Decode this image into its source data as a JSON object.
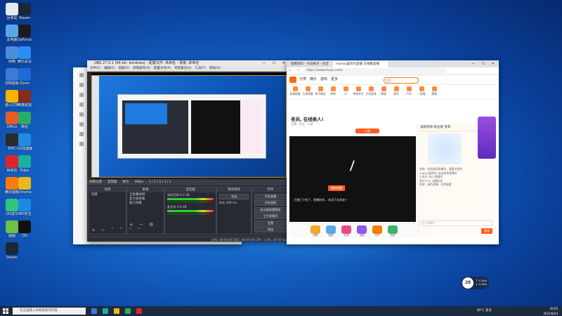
{
  "desktop": {
    "icons": [
      {
        "label": "回收站",
        "color": "#e6e9ee"
      },
      {
        "label": "Steam",
        "color": "#1b2838"
      },
      {
        "label": "此电脑",
        "color": "#5aa7e8"
      },
      {
        "label": "GeForce",
        "color": "#1c1c1c"
      },
      {
        "label": "网络",
        "color": "#4a8fd8"
      },
      {
        "label": "腾讯会议",
        "color": "#2d8cf0"
      },
      {
        "label": "控制面板",
        "color": "#3a7bd5"
      },
      {
        "label": "Zoom",
        "color": "#1e6ad6"
      },
      {
        "label": "金山文档",
        "color": "#f5b400"
      },
      {
        "label": "英雄联盟",
        "color": "#8a2a1a"
      },
      {
        "label": "Office",
        "color": "#e65b2a"
      },
      {
        "label": "微信",
        "color": "#2aae67"
      },
      {
        "label": "EPIC",
        "color": "#2a2a2a"
      },
      {
        "label": "UU加速器",
        "color": "#1f8ce3"
      },
      {
        "label": "网易云",
        "color": "#e0242a"
      },
      {
        "label": "Edge",
        "color": "#1bb0a1"
      },
      {
        "label": "腾讯视频",
        "color": "#ff7a00"
      },
      {
        "label": "Chrome",
        "color": "#e8b91f"
      },
      {
        "label": "QQ音乐",
        "color": "#31c27c"
      },
      {
        "label": "360安全",
        "color": "#1a8ae6"
      },
      {
        "label": "画图",
        "color": "#6fbf4a"
      },
      {
        "label": "QQ",
        "color": "#111111"
      },
      {
        "label": "Steam",
        "color": "#1b2838"
      }
    ]
  },
  "obs": {
    "title": "OBS 27.0.1 (64-bit, windows) - 配置文件: 未命名 - 场景: 未命名",
    "menu": [
      "文件(F)",
      "编辑(E)",
      "视图(V)",
      "停靠部件(D)",
      "配置文件(P)",
      "场景集合(S)",
      "工具(T)",
      "帮助(H)"
    ],
    "window_controls": "— ☐ ✕",
    "tabs": [
      "场景过渡",
      "混音器",
      "统计",
      "30fps",
      "1 / 1 / 1 / 1 / 1"
    ],
    "scenes_header": "场景",
    "scenes": [
      "场景"
    ],
    "sources_header": "来源",
    "sources": [
      "全屏幕录制",
      "显示器采集",
      "窗口采集"
    ],
    "mixer_header": "混音器",
    "mixer_channels": [
      {
        "name": "桌面音频",
        "level": "0.0 dB"
      },
      {
        "name": "麦克风",
        "level": "0.0 dB"
      }
    ],
    "transition_header": "转场特效",
    "transition_value": "淡出",
    "duration_label": "时长",
    "duration_value": "300 ms",
    "controls_header": "控件",
    "controls": [
      "开始直播",
      "开始录制",
      "启动虚拟摄像机",
      "工作室模式",
      "设置",
      "退出"
    ],
    "status": "LIVE: 00:00:00    REC: 00:00:00    CPU: 1.0%, 30.00 fps"
  },
  "browser": {
    "tabs": [
      {
        "label": "招聘资料 - 今日奇点 - 抖音",
        "active": false
      },
      {
        "label": "money喜欢吗直播 在线看直播",
        "active": true
      }
    ],
    "window_controls": "— ☐ ✕",
    "nav": "← → ⟳",
    "url": "https://www.huya.com/",
    "site_nav": [
      "分类",
      "娱乐",
      "游戏",
      "更多"
    ],
    "search_placeholder": "搜索",
    "categories": [
      "英雄联盟",
      "王者荣耀",
      "和平精英",
      "原神",
      "CF",
      "绝地求生",
      "主机游戏",
      "颜值",
      "星秀",
      "户外",
      "一起看",
      "赛事"
    ],
    "room_title": "老兵, 在线卖人!",
    "room_meta": "主播 · 关注 · 分享",
    "follow_label": "订阅",
    "video_button": "重新加载",
    "video_message": "主播已下线了，直播结束... 欢迎下次再来~",
    "gifts": [
      {
        "label": "虎粮",
        "color": "#f6a623"
      },
      {
        "label": "藏宝",
        "color": "#5aa7e8"
      },
      {
        "label": "礼物",
        "color": "#e84a8b"
      },
      {
        "label": "宝箱",
        "color": "#8a5ae8"
      },
      {
        "label": "守护",
        "color": "#ff7a00"
      },
      {
        "label": "贵族",
        "color": "#3ab46a"
      }
    ],
    "rank_header": "贡献周榜   粉丝榜   贵宾",
    "chat_lines": [
      "系统：欢迎来到直播间，请遵守规则",
      "money喜欢吗: 欢迎来到直播间",
      "小虎牙: 进入直播间",
      "观众123: 主播加油",
      "系统：绿色直播，文明观看"
    ],
    "chat_placeholder": "发个弹幕吧~",
    "send_label": "发送"
  },
  "taskbar": {
    "search_placeholder": "在这里输入你要搜索的内容",
    "apps": [
      "#3a7bd5",
      "#1bb0a1",
      "#e8b91f",
      "#2aae67",
      "#e0242a"
    ],
    "weather": "26°C 多云",
    "time": "20:05",
    "date": "2021/6/24"
  },
  "float_widget": {
    "number": "28",
    "line1": "↑ 0.1K/s",
    "line2": "↓ 0.2K/s"
  }
}
